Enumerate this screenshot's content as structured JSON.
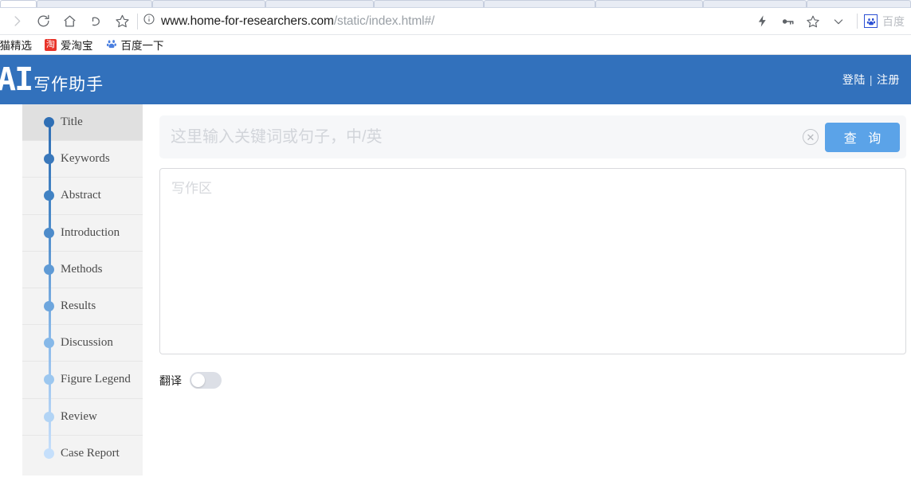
{
  "browser": {
    "nav_icons": [
      {
        "name": "forward-icon",
        "glyph": "forward"
      },
      {
        "name": "reload-icon",
        "glyph": "reload"
      },
      {
        "name": "home-icon",
        "glyph": "home"
      },
      {
        "name": "undo-icon",
        "glyph": "undo"
      },
      {
        "name": "bookmark-star-icon",
        "glyph": "star"
      }
    ],
    "url": {
      "host": "www.home-for-researchers.com",
      "path": "/static/index.html#/"
    },
    "security_icon": "info-circle-icon",
    "right_icons": [
      {
        "name": "lightning-icon",
        "glyph": "bolt"
      },
      {
        "name": "key-icon",
        "glyph": "key"
      },
      {
        "name": "star-icon",
        "glyph": "star"
      },
      {
        "name": "chevron-down-icon",
        "glyph": "chevron"
      }
    ],
    "extension": {
      "icon": "baidu-paw-icon",
      "label": "百度"
    },
    "bookmarks": [
      {
        "label": "天猫精选",
        "icon": ""
      },
      {
        "label": "爱淘宝",
        "icon": "淘"
      },
      {
        "label": "百度一下",
        "icon": "baidu-paw-icon"
      }
    ]
  },
  "app": {
    "logo_mark": "AI",
    "logo_text": "写作助手",
    "auth": {
      "login": "登陆",
      "separator": "|",
      "register": "注册"
    }
  },
  "sidebar": {
    "items": [
      {
        "label": "Title",
        "dot_color": "#2f6fb5",
        "active": true
      },
      {
        "label": "Keywords",
        "dot_color": "#3a78bb",
        "active": false
      },
      {
        "label": "Abstract",
        "dot_color": "#4182c3",
        "active": false
      },
      {
        "label": "Introduction",
        "dot_color": "#4d8bca",
        "active": false
      },
      {
        "label": "Methods",
        "dot_color": "#5f9ad5",
        "active": false
      },
      {
        "label": "Results",
        "dot_color": "#6ea6dd",
        "active": false
      },
      {
        "label": "Discussion",
        "dot_color": "#86b8e8",
        "active": false
      },
      {
        "label": "Figure Legend",
        "dot_color": "#9cc7ef",
        "active": false
      },
      {
        "label": "Review",
        "dot_color": "#b2d4f5",
        "active": false
      },
      {
        "label": "Case Report",
        "dot_color": "#c5dffb",
        "active": false
      }
    ]
  },
  "main": {
    "search": {
      "value": "",
      "placeholder": "这里输入关键词或句子，中/英",
      "clear_icon": "clear-circle-icon",
      "button_label": "查 询"
    },
    "editor": {
      "value": "",
      "placeholder": "写作区"
    },
    "translate": {
      "label": "翻译",
      "enabled": false
    }
  },
  "colors": {
    "header_blue": "#3271bc",
    "button_blue": "#5ba3e8",
    "sidebar_bg": "#f3f3f3",
    "sidebar_active": "#e0e0e0",
    "search_bg": "#f6f7f9"
  }
}
